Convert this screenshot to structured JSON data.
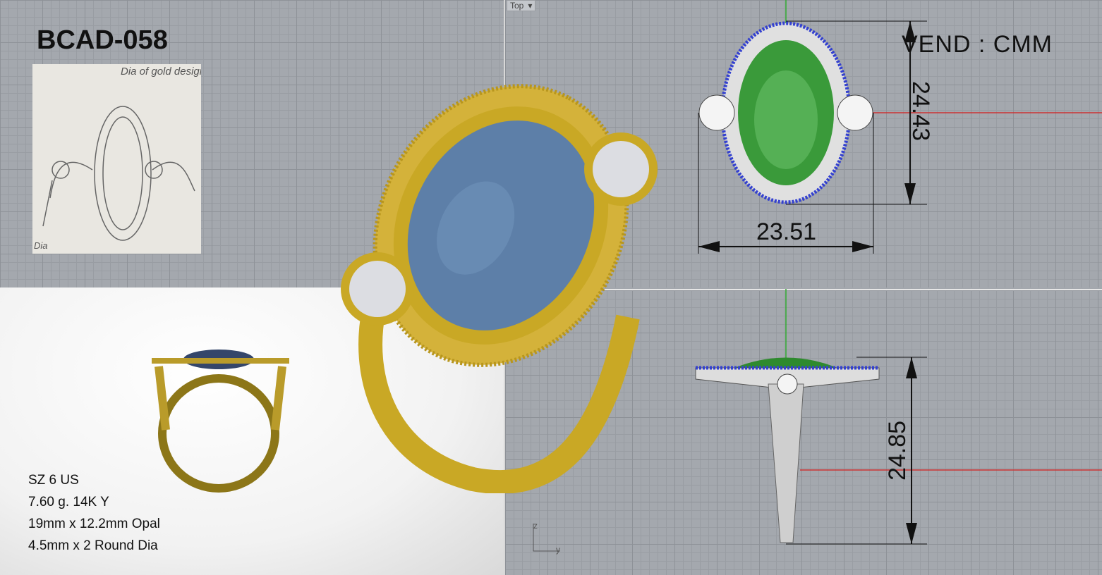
{
  "title": "BCAD-058",
  "sketch": {
    "notes": [
      "Dia of gold design",
      "Dia"
    ]
  },
  "specs": [
    "SZ 6 US",
    "7.60 g. 14K Y",
    "19mm x 12.2mm Opal",
    "4.5mm x 2 Round Dia"
  ],
  "viewport": {
    "name": "Top",
    "dropdown": "▾",
    "axes": {
      "vertical": "z",
      "horizontal": "y"
    }
  },
  "vend": "VEND : CMM",
  "dimensions": {
    "top_height": "24.43",
    "top_width": "23.51",
    "side_height": "24.85"
  },
  "colors": {
    "gold": "#c9a825",
    "opal": "#5d7fa8",
    "green": "#3a9a3a",
    "pave": "#3340d0"
  }
}
